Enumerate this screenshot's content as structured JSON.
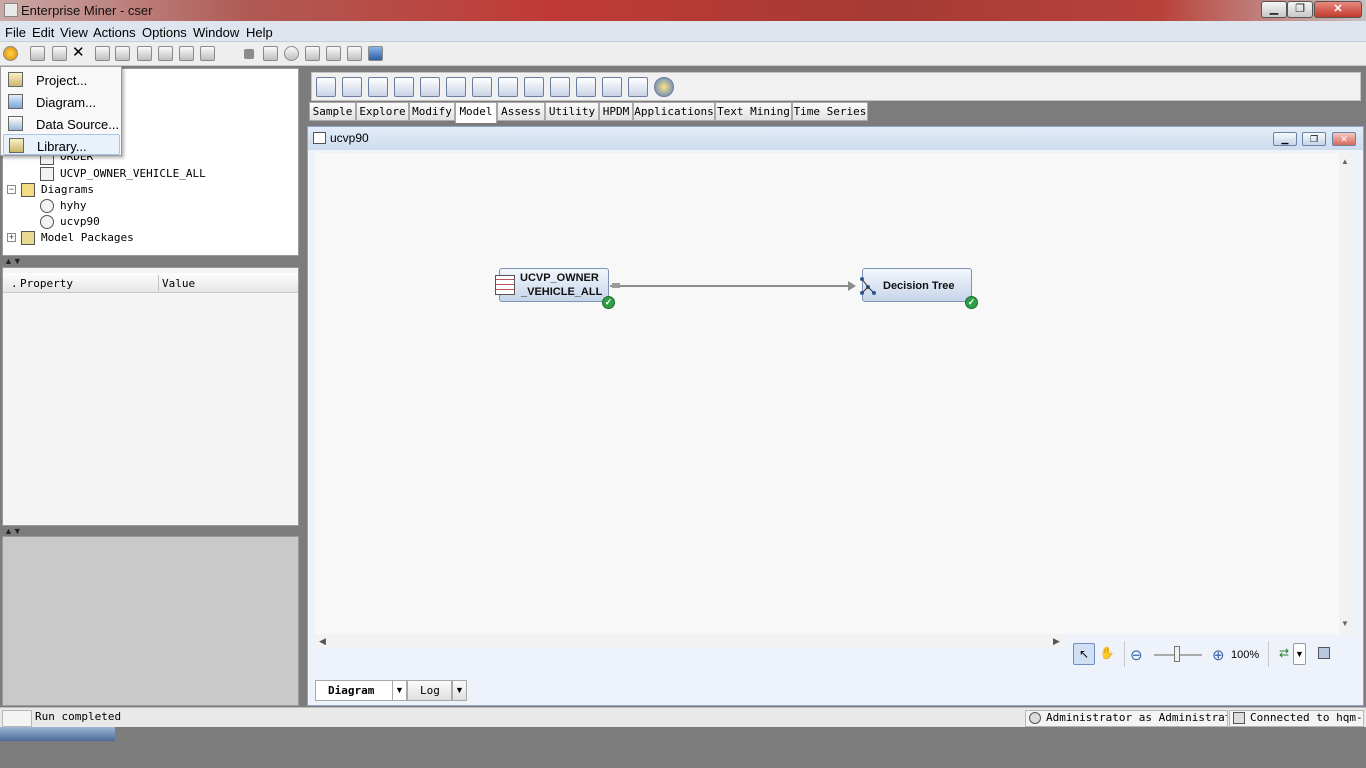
{
  "window": {
    "title": "Enterprise Miner - cser",
    "minimize": "▁",
    "maximize": "❐",
    "close": "✕"
  },
  "menu": [
    "File",
    "Edit",
    "View",
    "Actions",
    "Options",
    "Window",
    "Help"
  ],
  "new_menu": {
    "items": [
      "Project...",
      "Diagram...",
      "Data Source...",
      "Library..."
    ],
    "highlighted": "Library..."
  },
  "tree": {
    "datasource_partial": "ORDER",
    "datasource": "UCVP_OWNER_VEHICLE_ALL",
    "diagrams_folder": "Diagrams",
    "diagrams": [
      "hyhy",
      "ucvp90"
    ],
    "model_packages": "Model Packages"
  },
  "properties": {
    "col_dot": ".",
    "col_property": "Property",
    "col_value": "Value"
  },
  "node_tabs": [
    "Sample",
    "Explore",
    "Modify",
    "Model",
    "Assess",
    "Utility",
    "HPDM",
    "Applications",
    "Text Mining",
    "Time Series"
  ],
  "active_tab": "Model",
  "diagram": {
    "name": "ucvp90",
    "nodes": [
      {
        "label_line1": "UCVP_OWNER",
        "label_line2": "_VEHICLE_ALL",
        "status": "completed"
      },
      {
        "label_line1": "Decision Tree",
        "status": "completed"
      }
    ]
  },
  "zoom": {
    "level": "100%",
    "minus": "⊖",
    "plus": "⊕"
  },
  "bottom_tabs": {
    "diagram": "Diagram",
    "log": "Log"
  },
  "status": {
    "message": "Run completed",
    "user": "Administrator as Administrator",
    "connection": "Connected to hqm-PC"
  },
  "colors": {
    "titlebar": "#b03a35",
    "node_fill": "#d5e1f1",
    "check": "#2ea043"
  }
}
